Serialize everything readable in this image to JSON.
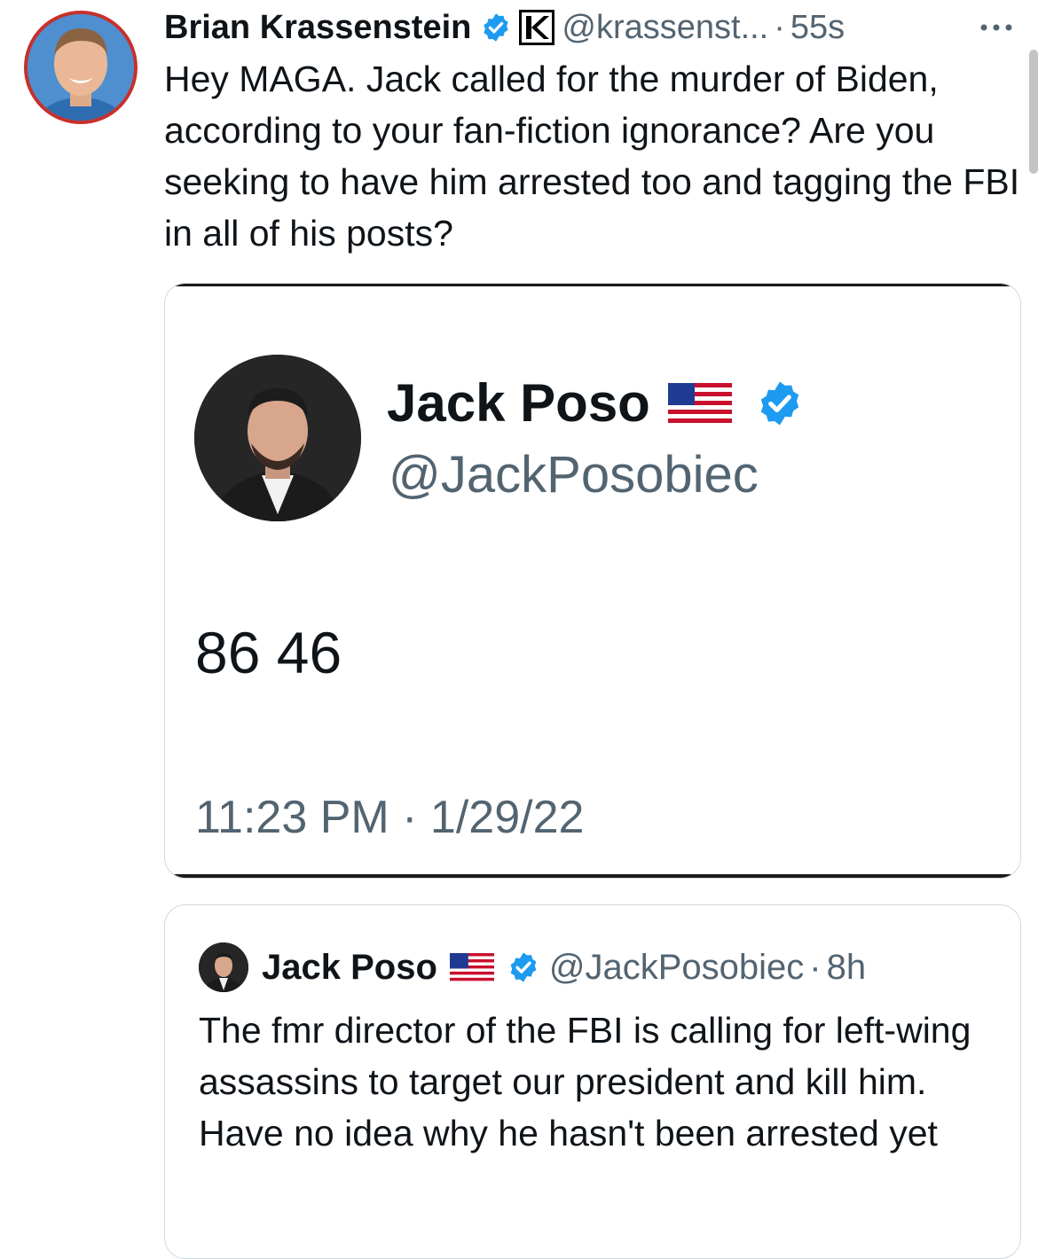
{
  "tweet": {
    "author_name": "Brian Krassenstein",
    "handle": "@krassenst...",
    "separator": "·",
    "time": "55s",
    "text": "Hey MAGA. Jack called for the murder of Biden, according to your fan-fiction ignorance?  Are you seeking to have him arrested too and tagging the FBI in all of his posts?"
  },
  "embedded_image": {
    "author_name": "Jack Poso",
    "handle": "@JackPosobiec",
    "body": "86 46",
    "timestamp": "11:23 PM · 1/29/22"
  },
  "quoted_tweet": {
    "author_name": "Jack Poso",
    "handle": "@JackPosobiec",
    "separator": "·",
    "time": "8h",
    "text": "The fmr director of the FBI is calling for left-wing assassins to target our president and kill him. Have no idea why he hasn't been arrested yet"
  },
  "icons": {
    "verified": "verified-badge-icon",
    "affiliate": "affiliate-k-icon",
    "more": "more-options-icon",
    "flag": "us-flag-icon"
  },
  "colors": {
    "verified_blue": "#1d9bf0",
    "secondary_text": "#536471",
    "border": "#cfd9de",
    "avatar_ring": "#c8302b"
  }
}
